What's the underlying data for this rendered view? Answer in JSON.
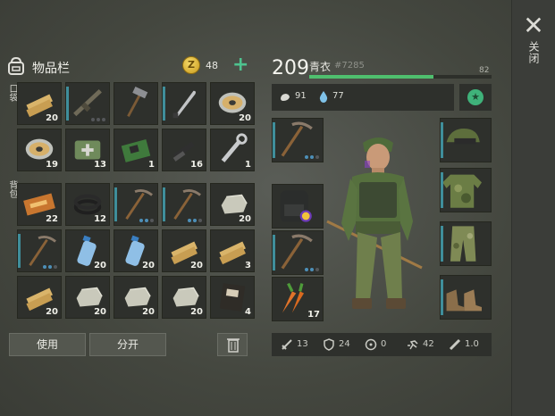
{
  "close": {
    "label": "关闭"
  },
  "inventory": {
    "title": "物品栏",
    "coins": "48",
    "pocket_label": "口袋",
    "backpack_label": "背包",
    "pocket_slots": [
      {
        "item": "wood-plank",
        "qty": "20"
      },
      {
        "item": "assault-rifle",
        "qty": "",
        "dots": [
          0,
          0,
          0
        ]
      },
      {
        "item": "pickaxe-hammer",
        "qty": ""
      },
      {
        "item": "machete",
        "qty": ""
      },
      {
        "item": "wire-spool",
        "qty": "20"
      },
      {
        "item": "wire-spool",
        "qty": "19"
      },
      {
        "item": "first-aid-kit",
        "qty": "13"
      },
      {
        "item": "circuit-board",
        "qty": "1"
      },
      {
        "item": "gun-parts",
        "qty": "16"
      },
      {
        "item": "wrench",
        "qty": "1"
      }
    ],
    "backpack_slots": [
      {
        "item": "coupon",
        "qty": "22"
      },
      {
        "item": "rubber-rings",
        "qty": "12"
      },
      {
        "item": "pickaxe",
        "qty": "",
        "dots": [
          1,
          1,
          0
        ]
      },
      {
        "item": "pickaxe",
        "qty": "",
        "dots": [
          1,
          1,
          0
        ]
      },
      {
        "item": "stone",
        "qty": "20"
      },
      {
        "item": "pickaxe",
        "qty": "",
        "dots": [
          1,
          1,
          0
        ]
      },
      {
        "item": "water-bottle",
        "qty": "20"
      },
      {
        "item": "water-bottle",
        "qty": "20"
      },
      {
        "item": "wood-plank",
        "qty": "20"
      },
      {
        "item": "wood-plank",
        "qty": "3"
      },
      {
        "item": "wood-plank",
        "qty": "20"
      },
      {
        "item": "stone",
        "qty": "20"
      },
      {
        "item": "stone",
        "qty": "20"
      },
      {
        "item": "stone",
        "qty": "20"
      },
      {
        "item": "notebook",
        "qty": "4"
      }
    ],
    "use_label": "使用",
    "split_label": "分开"
  },
  "character": {
    "level": "209",
    "name": "青衣",
    "id": "#7285",
    "xp_max": "82",
    "xp_progress": 0.68,
    "food": "91",
    "water": "77",
    "weapon_slots": [
      {
        "item": "pickaxe",
        "qty": "",
        "dots": [
          1,
          1,
          0
        ]
      },
      {
        "item": "backpack",
        "qty": ""
      },
      {
        "item": "pickaxe",
        "qty": "",
        "dots": [
          1,
          1,
          0
        ]
      },
      {
        "item": "carrots",
        "qty": "17"
      }
    ],
    "armor_slots": [
      {
        "item": "helmet-cap"
      },
      {
        "item": "camo-jacket"
      },
      {
        "item": "camo-pants"
      },
      {
        "item": "boots"
      }
    ],
    "attributes": [
      {
        "icon": "sword-icon",
        "value": "13"
      },
      {
        "icon": "shield-icon",
        "value": "24"
      },
      {
        "icon": "radiation-icon",
        "value": "0"
      },
      {
        "icon": "speed-icon",
        "value": "42"
      },
      {
        "icon": "weight-icon",
        "value": "1.0"
      }
    ]
  },
  "colors": {
    "accent_blue": "#3f8e9b",
    "xp_green": "#4fbf6e",
    "plus_green": "#4ec38f"
  }
}
